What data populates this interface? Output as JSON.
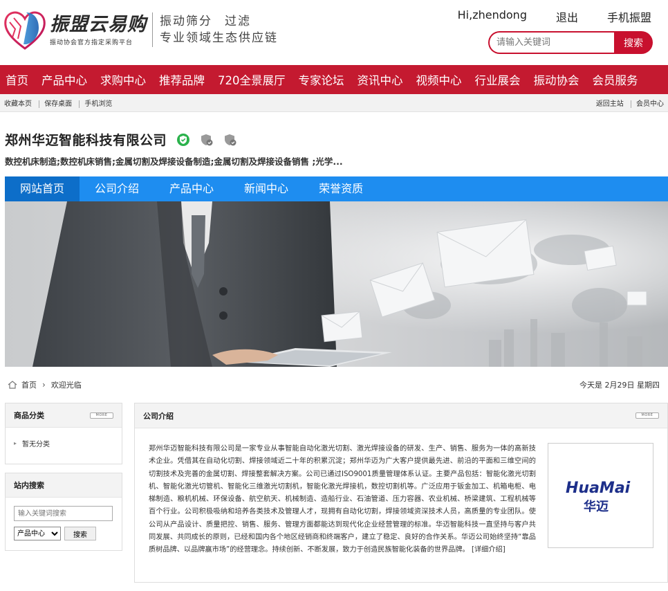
{
  "header": {
    "logo_name": "振盟云易购",
    "logo_tagline": "振动协会官方指定采购平台",
    "slogan_line1_a": "振动筛分",
    "slogan_line1_b": "过滤",
    "slogan_line2": "专业领域生态供应链",
    "greeting": "Hi,zhendong",
    "logout": "退出",
    "mobile": "手机振盟",
    "search_placeholder": "请输入关键词",
    "search_button": "搜索"
  },
  "main_nav": [
    "首页",
    "产品中心",
    "求购中心",
    "推荐品牌",
    "720全景展厅",
    "专家论坛",
    "资讯中心",
    "视频中心",
    "行业展会",
    "振动协会",
    "会员服务"
  ],
  "util_bar": {
    "left": [
      "收藏本页",
      "保存桌面",
      "手机浏览"
    ],
    "right": [
      "返回主站",
      "会员中心"
    ]
  },
  "company": {
    "name": "郑州华迈智能科技有限公司",
    "business": "数控机床制造;数控机床销售;金属切割及焊接设备制造;金属切割及焊接设备销售 ;光学..."
  },
  "site_nav": [
    "网站首页",
    "公司介绍",
    "产品中心",
    "新闻中心",
    "荣誉资质"
  ],
  "breadcrumb": {
    "home": "首页",
    "current": "欢迎光临",
    "date_text": "今天是 2月29日 星期四"
  },
  "sidebar": {
    "categories_title": "商品分类",
    "more_label": "MORE",
    "categories": [
      "暂无分类"
    ],
    "search_title": "站内搜索",
    "search_placeholder": "输入关键词搜索",
    "select_value": "产品中心",
    "search_button": "搜索"
  },
  "intro": {
    "title": "公司介绍",
    "text": "郑州华迈智能科技有限公司是一家专业从事智能自动化激光切割、激光焊接设备的研发、生产、销售、服务为一体的高新技术企业。凭借其在自动化切割、焊接领域近二十年的积累沉淀；郑州华迈为广大客户提供最先进、前沿的平面和三维空间的切割技术及完善的金属切割、焊接整套解决方案。公司已通过ISO9001质量管理体系认证。主要产品包括：智能化激光切割机、智能化激光切管机、智能化三维激光切割机，智能化激光焊接机，数控切割机等。广泛应用于钣金加工、机箱电柜、电梯制造、粮机机械、环保设备、航空航天、机械制造、造船行业、石油管道、压力容器、农业机械、桥梁建筑、工程机械等百个行业。公司积极吸纳和培养各类技术及管理人才，现拥有自动化切割，焊接领域资深技术人员，高质量的专业团队。使公司从产品设计、质量把控、销售、服务、管理方面都能达到现代化企业经营管理的标准。华迈智能科技一直坚持与客户共同发展、共同成长的原则，已经和国内各个地区经销商和终端客户，建立了稳定、良好的合作关系。华迈公司始终坚持“靠品质树品牌、以品牌赢市场”的经营理念。持续创新、不断发展，致力于创造民族智能化装备的世界品牌。",
    "detail_link": "[详细介绍]",
    "logo_latin": "HuaMai",
    "logo_cn": "华迈"
  },
  "colors": {
    "brand_red": "#c41a30",
    "site_nav_blue": "#1e8df0",
    "site_nav_active": "#0d6ec9"
  }
}
